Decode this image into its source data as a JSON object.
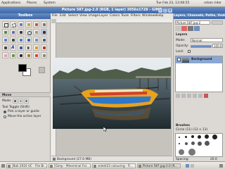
{
  "top_panel": {
    "menus": [
      "Applications",
      "Places",
      "System"
    ],
    "clock": "Tue Feb 23, 13:08:55",
    "user": "rohan rider"
  },
  "window": {
    "title": "Picture 587.jpg-2.0 (RGB, 1 layer) 3056x1728 – GIMP",
    "menus": [
      "File",
      "Edit",
      "Select",
      "View",
      "Image",
      "Layer",
      "Colors",
      "Tools",
      "Filters",
      "Windows",
      "Help"
    ]
  },
  "toolbox": {
    "title": "Toolbox",
    "tool_options_title": "Move",
    "mode_label": "Mode:",
    "tool_toggle_label": "Tool Toggle (Shift)",
    "option_pick_layer": "Pick a layer or guide",
    "option_move_active": "Move the active layer"
  },
  "status": {
    "layer_info": "Background (27.6 MB)"
  },
  "dock": {
    "title": "Layers, Channels, Paths, Undo...",
    "image_select": "Picture 587.jpg-2",
    "layers_label": "Layers",
    "mode_label": "Mode:",
    "mode_value": "Normal",
    "opacity_label": "Opacity:",
    "opacity_value": "100.0",
    "lock_label": "Lock:",
    "layer_name": "Background",
    "brushes_label": "Brushes",
    "brush_name": "Circle (11) (13 × 13)",
    "spacing_label": "Spacing:",
    "spacing_value": "20.0"
  },
  "taskbar": {
    "items": [
      "[Bali-2010 UC - File Br...",
      "[Gimp - Mineminal Fol...",
      "selekt23 colouring - Fi...",
      "Picture 587.jpg-2.0 (R..."
    ]
  }
}
